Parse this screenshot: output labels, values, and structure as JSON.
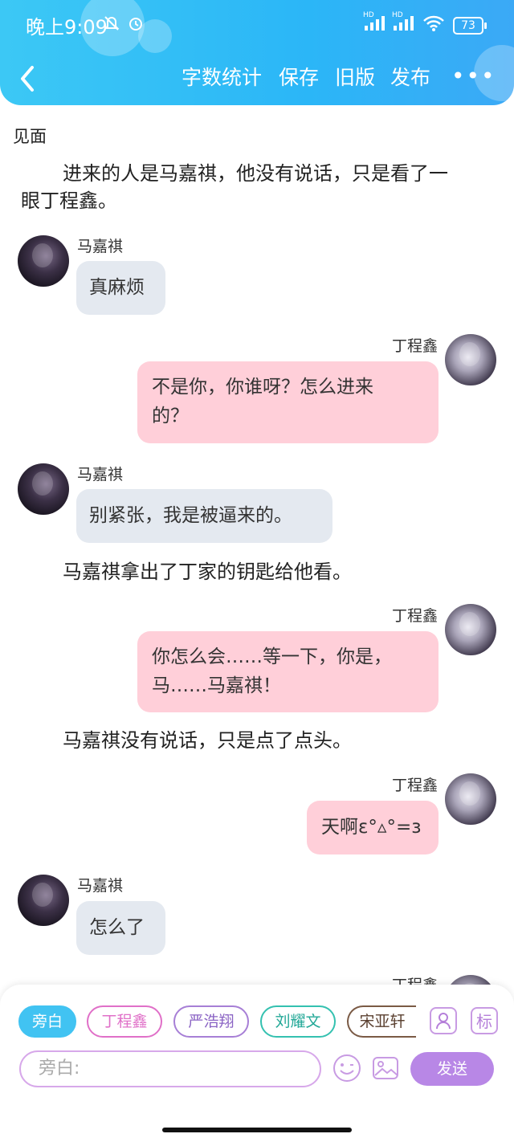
{
  "status_bar": {
    "time": "晚上9:09",
    "battery": "73",
    "signal1": "HD",
    "signal2": "HD"
  },
  "toolbar": {
    "word_count": "字数统计",
    "save": "保存",
    "old_version": "旧版",
    "publish": "发布",
    "more": "•••"
  },
  "chapter_title": "见面",
  "story": {
    "n1_line1": "进来的人是马嘉祺，他没有说话，只是看了一",
    "n1_line2": "眼丁程鑫。",
    "m1_name": "马嘉祺",
    "m1_text": "真麻烦",
    "m2_name": "丁程鑫",
    "m2_line1": "不是你，你谁呀？怎么进来",
    "m2_line2": "的？",
    "m3_name": "马嘉祺",
    "m3_text": "别紧张，我是被逼来的。",
    "n2": "马嘉祺拿出了丁家的钥匙给他看。",
    "m4_name": "丁程鑫",
    "m4_line1": "你怎么会……等一下，你是，",
    "m4_line2": "马……马嘉祺！",
    "n3": "马嘉祺没有说话，只是点了点头。",
    "m5_name": "丁程鑫",
    "m5_text": "天啊ε°▵°=з",
    "m6_name": "马嘉祺",
    "m6_text": "怎么了",
    "m7_name": "丁程鑫"
  },
  "roles": [
    "旁白",
    "丁程鑫",
    "严浩翔",
    "刘耀文",
    "宋亚轩"
  ],
  "role_colors": {
    "active": "#41c3f2",
    "ding": "#e070c8",
    "yan": "#a77fd6",
    "liu": "#34c1b0",
    "song": "#7a5a45"
  },
  "bottom_bar": {
    "mark_icon": "标",
    "input_placeholder": "旁白:",
    "send": "发送"
  },
  "colors": {
    "header": "#2bb6f7",
    "left_bubble": "#e4e9f0",
    "right_bubble": "#ffcfd9",
    "send_button": "#b887e6"
  }
}
